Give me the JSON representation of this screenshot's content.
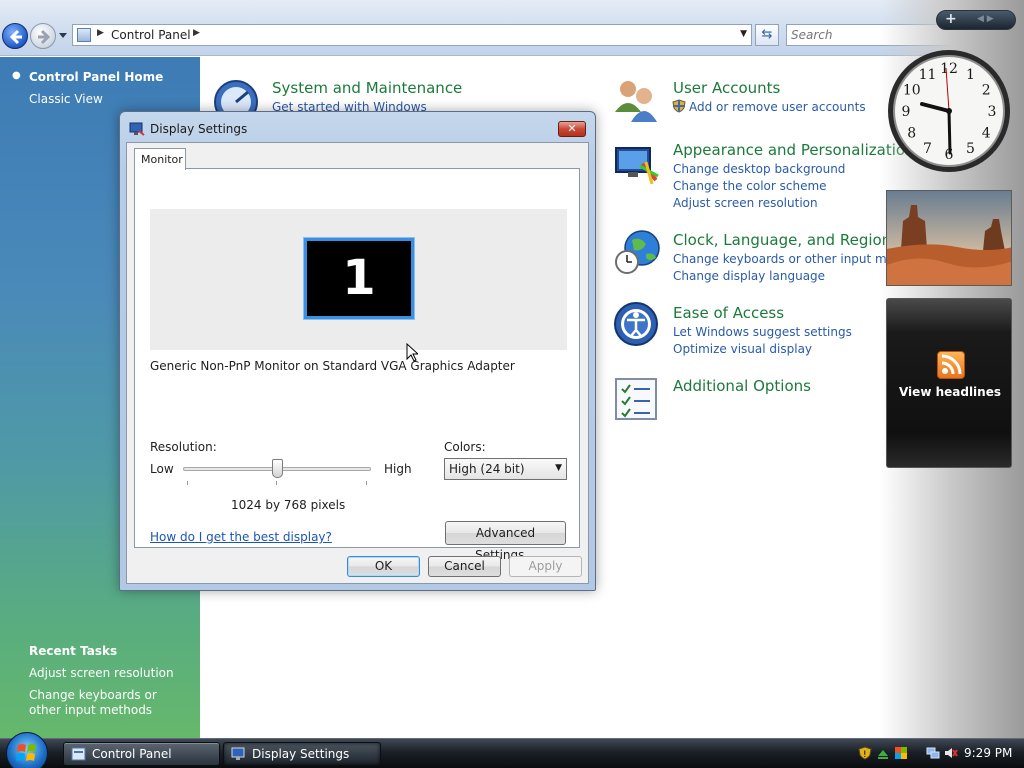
{
  "explorer": {
    "address": "Control Panel",
    "search_placeholder": "Search"
  },
  "sidebar": {
    "home": "Control Panel Home",
    "classic": "Classic View",
    "recent_title": "Recent Tasks",
    "recent": [
      "Adjust screen resolution",
      "Change keyboards or other input methods"
    ]
  },
  "categories": [
    {
      "title": "System and Maintenance",
      "links": [
        "Get started with Windows"
      ]
    },
    {
      "title": "User Accounts",
      "links": [
        "Add or remove user accounts"
      ]
    },
    {
      "title": "Appearance and Personalization",
      "links": [
        "Change desktop background",
        "Change the color scheme",
        "Adjust screen resolution"
      ]
    },
    {
      "title": "Clock, Language, and Region",
      "links": [
        "Change keyboards or other input methods",
        "Change display language"
      ]
    },
    {
      "title": "Ease of Access",
      "links": [
        "Let Windows suggest settings",
        "Optimize visual display"
      ]
    },
    {
      "title": "Additional Options",
      "links": []
    }
  ],
  "gadgets": {
    "feeds_label": "View headlines",
    "clock_numerals": [
      "12",
      "1",
      "2",
      "3",
      "4",
      "5",
      "6",
      "7",
      "8",
      "9",
      "10",
      "11"
    ]
  },
  "dialog": {
    "title": "Display Settings",
    "tab": "Monitor",
    "monitor_number": "1",
    "monitor_desc": "Generic Non-PnP Monitor on Standard VGA Graphics Adapter",
    "resolution_label": "Resolution:",
    "low": "Low",
    "high": "High",
    "resolution_value": "1024 by 768 pixels",
    "resolution_level": 0.5,
    "colors_label": "Colors:",
    "colors_value": "High (24 bit)",
    "help_link": "How do I get the best display?",
    "advanced_btn": "Advanced Settings...",
    "ok": "OK",
    "cancel": "Cancel",
    "apply": "Apply"
  },
  "taskbar": {
    "tasks": [
      "Control Panel",
      "Display Settings"
    ],
    "time": "9:29 PM"
  }
}
